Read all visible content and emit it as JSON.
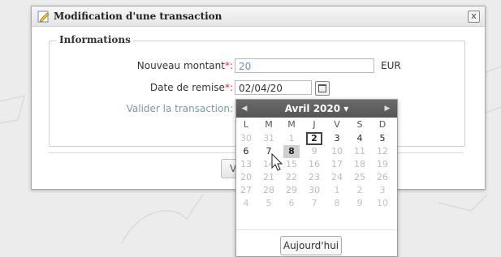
{
  "dialog": {
    "title": "Modification d'une transaction",
    "close_label": "x",
    "section_title": "Informations",
    "fields": {
      "amount": {
        "label": "Nouveau montant",
        "value": "20",
        "unit": "EUR"
      },
      "date": {
        "label": "Date de remise",
        "value": "02/04/20"
      },
      "validate": {
        "label": "Valider la transaction:"
      }
    },
    "required_mark": "*:",
    "submit_label": "Valider"
  },
  "datepicker": {
    "month_label": "Avril 2020 ▾",
    "prev": "◀",
    "next": "▶",
    "weekdays": [
      "L",
      "M",
      "M",
      "J",
      "V",
      "S",
      "D"
    ],
    "weeks": [
      [
        "30",
        "31",
        "1",
        "2",
        "3",
        "4",
        "5"
      ],
      [
        "6",
        "7",
        "8",
        "9",
        "10",
        "11",
        "12"
      ],
      [
        "13",
        "14",
        "15",
        "16",
        "17",
        "18",
        "19"
      ],
      [
        "20",
        "21",
        "22",
        "23",
        "24",
        "25",
        "26"
      ],
      [
        "27",
        "28",
        "29",
        "30",
        "1",
        "2",
        "3"
      ],
      [
        "4",
        "5",
        "6",
        "7",
        "8",
        "9",
        "10"
      ]
    ],
    "today_label": "Aujourd'hui",
    "colors": {
      "header": "#5e5e5e",
      "required": "#e22222"
    }
  }
}
